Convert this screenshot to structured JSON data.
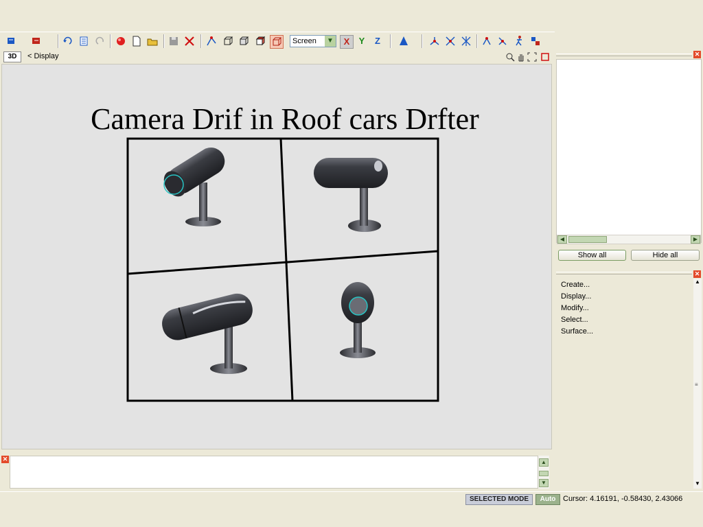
{
  "toolbar": {
    "view_mode_value": "Screen",
    "axis_x": "X",
    "axis_y": "Y",
    "axis_z": "Z",
    "icons": [
      "open-icon",
      "save-icon",
      "undo-icon",
      "properties-icon",
      "redo-icon",
      "record-icon",
      "new-file-icon",
      "open-folder-icon",
      "disk-icon",
      "delete-icon",
      "select-mode-icon",
      "cube-icon",
      "cube-icon",
      "cube-icon",
      "cube-icon",
      "cone-icon",
      "axis-icon",
      "axis-icon",
      "axis-icon",
      "figure-icon",
      "figure-icon",
      "figure-icon",
      "figure-icon"
    ]
  },
  "viewport": {
    "view_label": "3D",
    "breadcrumb": "< Display",
    "title": "Camera Drif in Roof cars Drfter"
  },
  "objects_panel": {
    "show_all_label": "Show all",
    "hide_all_label": "Hide all"
  },
  "command_panel": {
    "items": [
      "Create...",
      "Display...",
      "Modify...",
      "Select...",
      "Surface..."
    ]
  },
  "status": {
    "mode": "SELECTED MODE",
    "auto": "Auto",
    "cursor": "Cursor: 4.16191, -0.58430, 2.43066"
  },
  "colors": {
    "chrome": "#ece9d8",
    "viewport_bg": "#e3e3e3",
    "close_red": "#e34a2a",
    "lens_cyan": "#27c4c4"
  }
}
